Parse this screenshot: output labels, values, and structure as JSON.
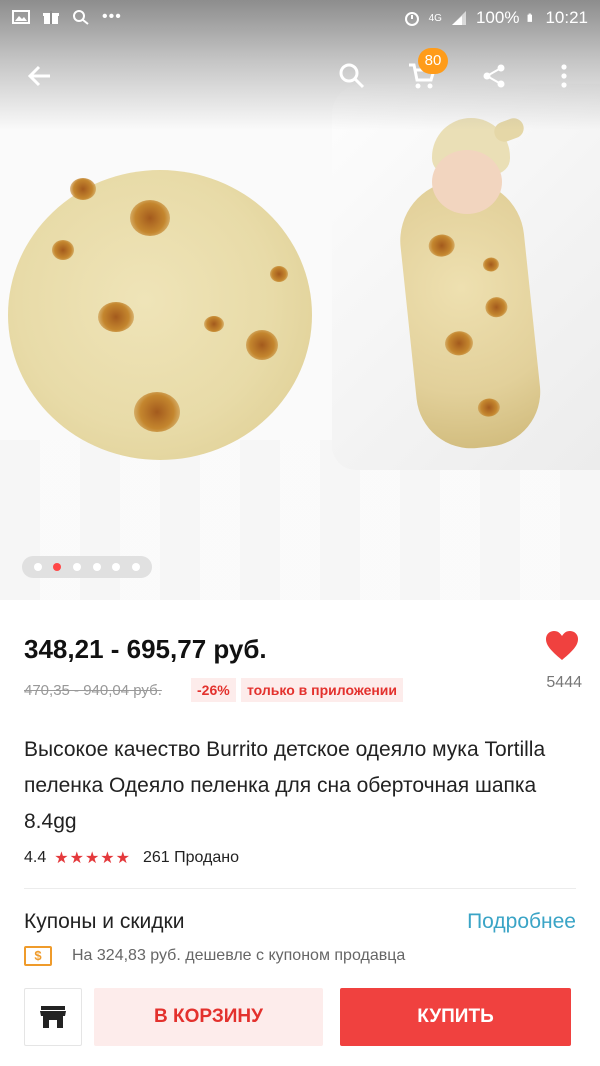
{
  "status_bar": {
    "icons_left": [
      "image-icon",
      "gift-icon",
      "search-icon",
      "more-icon"
    ],
    "network": "4G",
    "battery": "100%",
    "time": "10:21"
  },
  "toolbar": {
    "cart_badge": "80",
    "icons": [
      "back-arrow-icon",
      "search-icon",
      "cart-icon",
      "share-icon",
      "more-vert-icon"
    ]
  },
  "gallery": {
    "total_images": 6,
    "active_index": 1
  },
  "product": {
    "price": "348,21 - 695,77 руб.",
    "old_price": "470,35 - 940,04 руб.",
    "discount": "-26%",
    "app_only": "только в приложении",
    "likes": "5444",
    "title": "Высокое качество Burrito детское одеяло мука Tortilla пеленка Одеяло пеленка для сна оберточная шапка 8.4gg",
    "rating": "4.4",
    "stars": "★★★★★",
    "sold": "261 Продано"
  },
  "coupons": {
    "title": "Купоны и скидки",
    "more": "Подробнее",
    "icon_label": "$",
    "text": "На 324,83 руб. дешевле с купоном продавца"
  },
  "bottom_bar": {
    "cart_label": "В КОРЗИНУ",
    "buy_label": "КУПИТЬ"
  },
  "colors": {
    "accent_red": "#f0413f",
    "link_blue": "#3aa4c6",
    "badge_orange": "#ff9c1a"
  }
}
